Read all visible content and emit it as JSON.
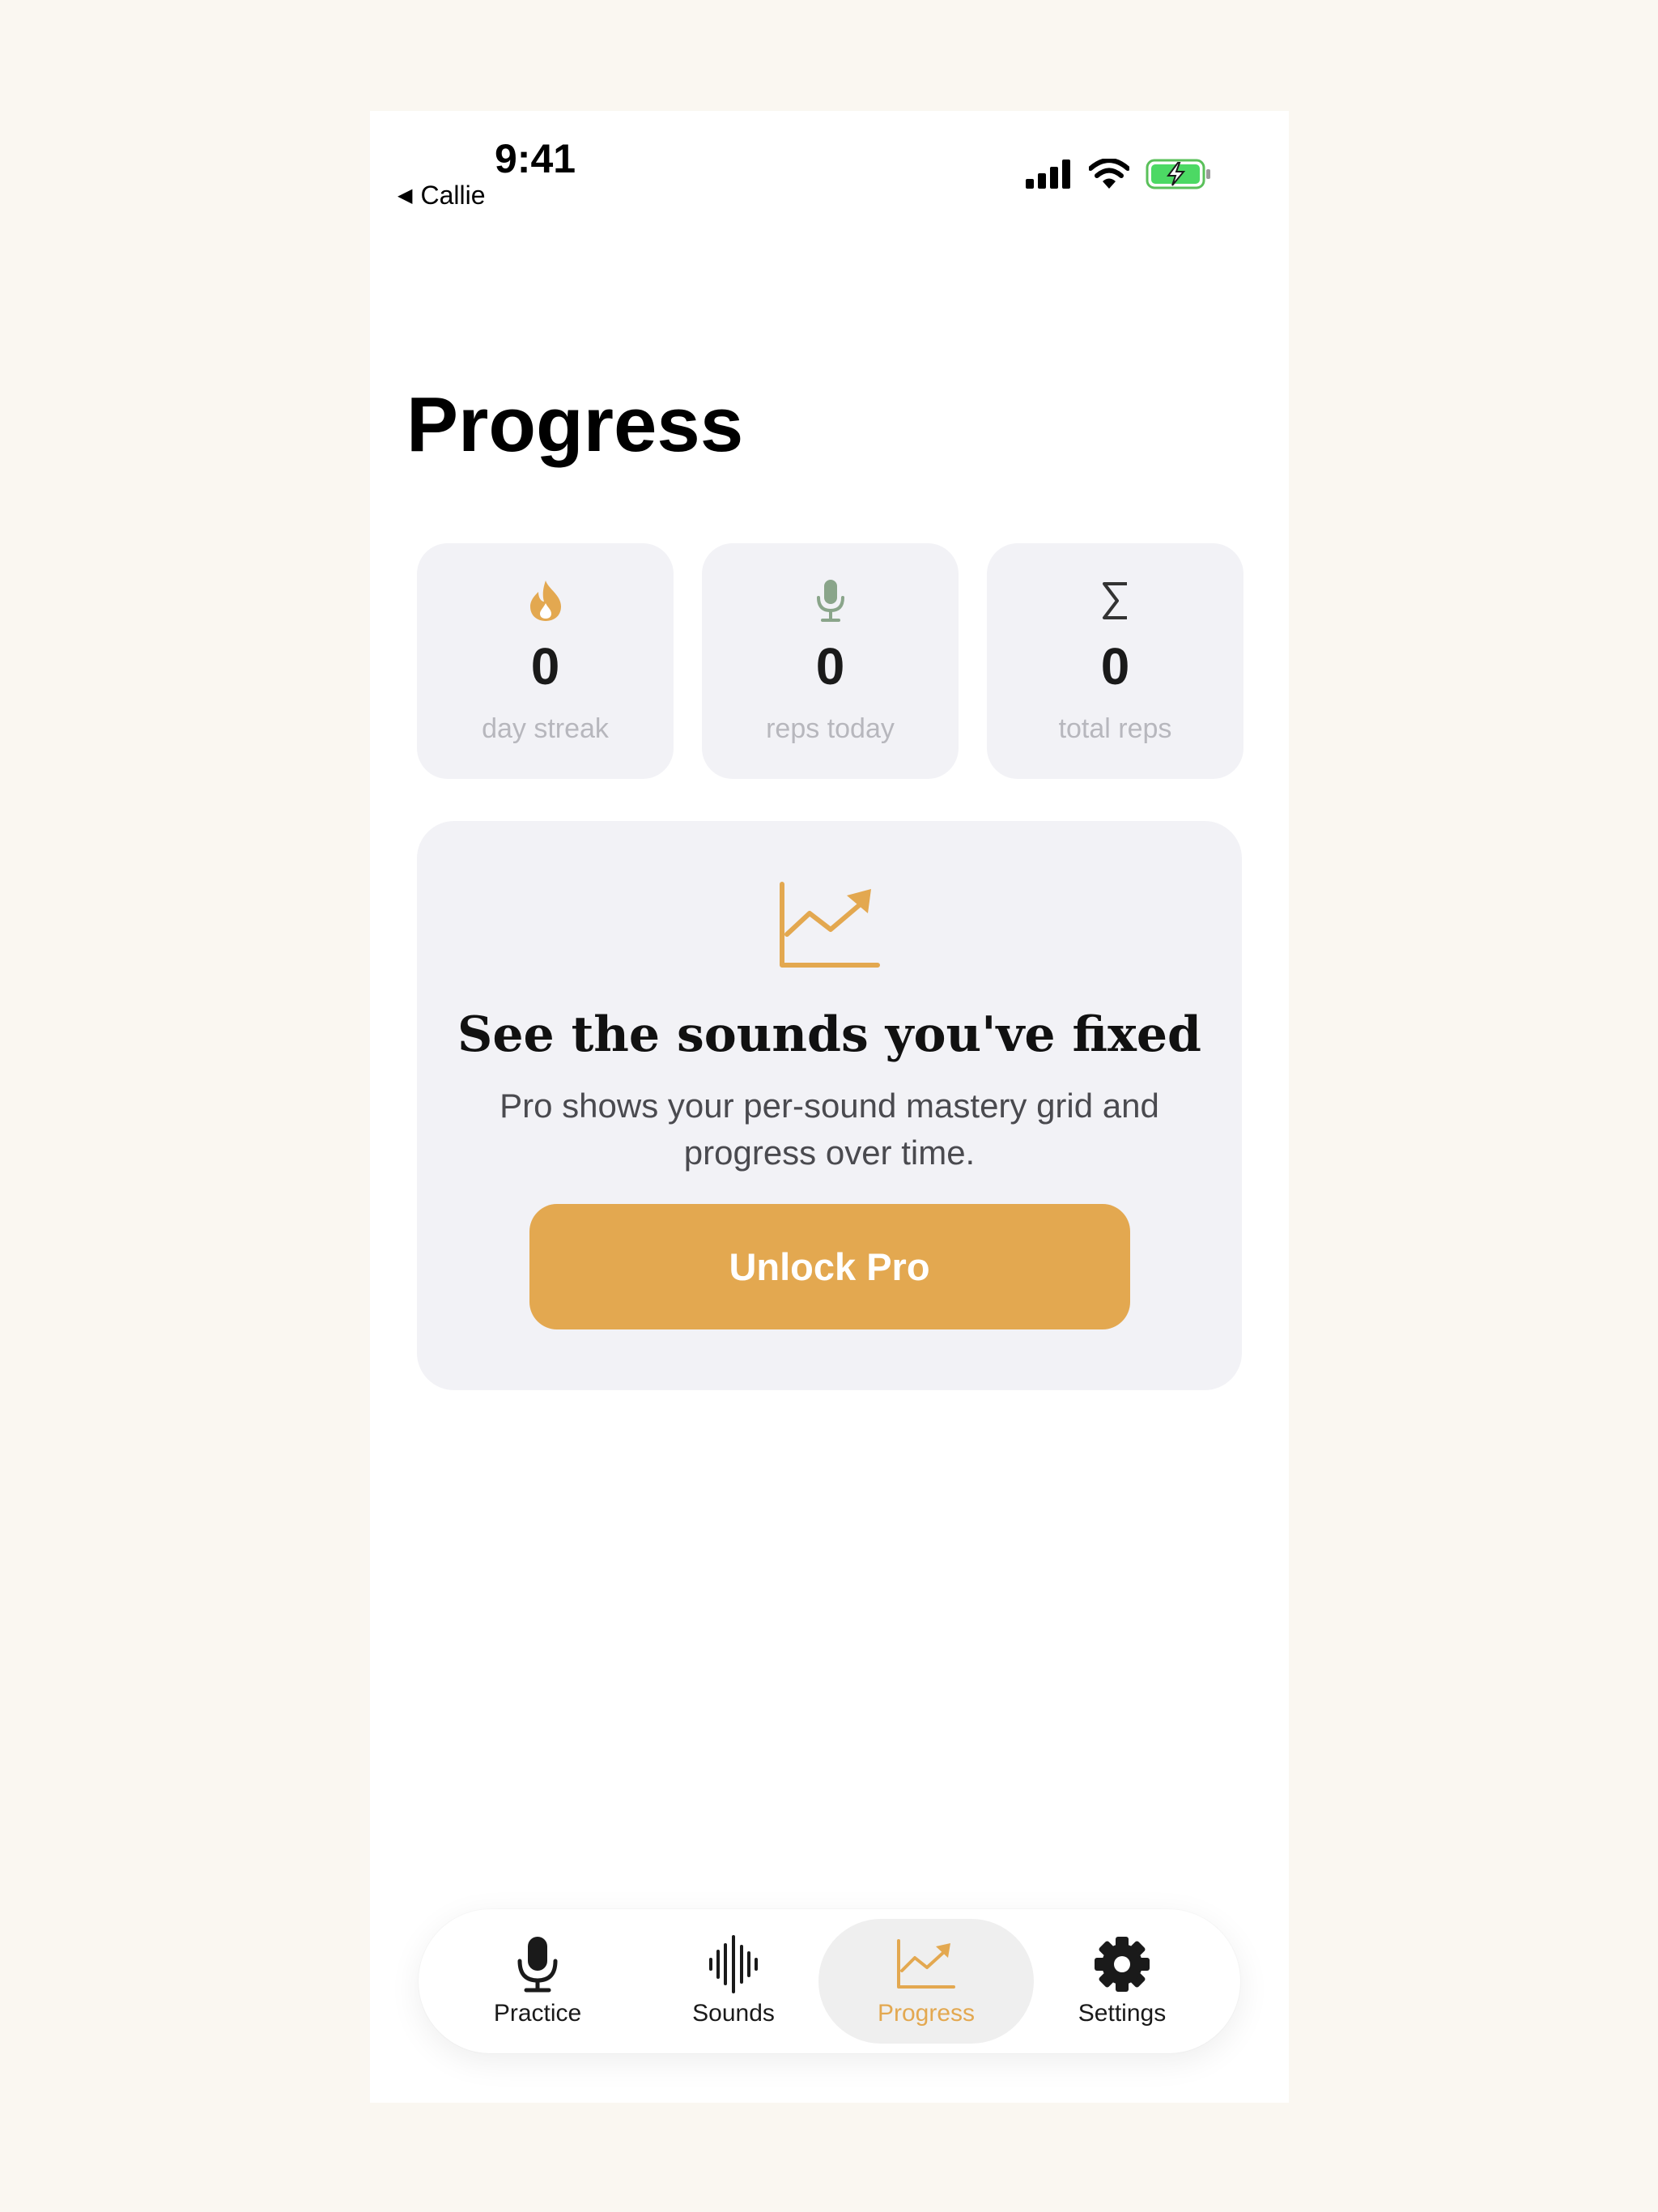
{
  "status_bar": {
    "time": "9:41",
    "back_label": "Callie"
  },
  "page": {
    "title": "Progress"
  },
  "stats": [
    {
      "icon": "flame-icon",
      "value": "0",
      "label": "day streak",
      "color": "#e3a850"
    },
    {
      "icon": "microphone-icon",
      "value": "0",
      "label": "reps today",
      "color": "#8aa58a"
    },
    {
      "icon": "sigma-icon",
      "value": "0",
      "label": "total reps",
      "color": "#333333"
    }
  ],
  "promo": {
    "icon": "chart-trend-icon",
    "title": "See the sounds you've fixed",
    "body": "Pro shows your per-sound mastery grid and progress over time.",
    "button_label": "Unlock Pro",
    "accent": "#e3a850"
  },
  "tabs": [
    {
      "icon": "microphone-icon",
      "label": "Practice",
      "active": false
    },
    {
      "icon": "waveform-icon",
      "label": "Sounds",
      "active": false
    },
    {
      "icon": "chart-trend-icon",
      "label": "Progress",
      "active": true
    },
    {
      "icon": "gear-icon",
      "label": "Settings",
      "active": false
    }
  ]
}
